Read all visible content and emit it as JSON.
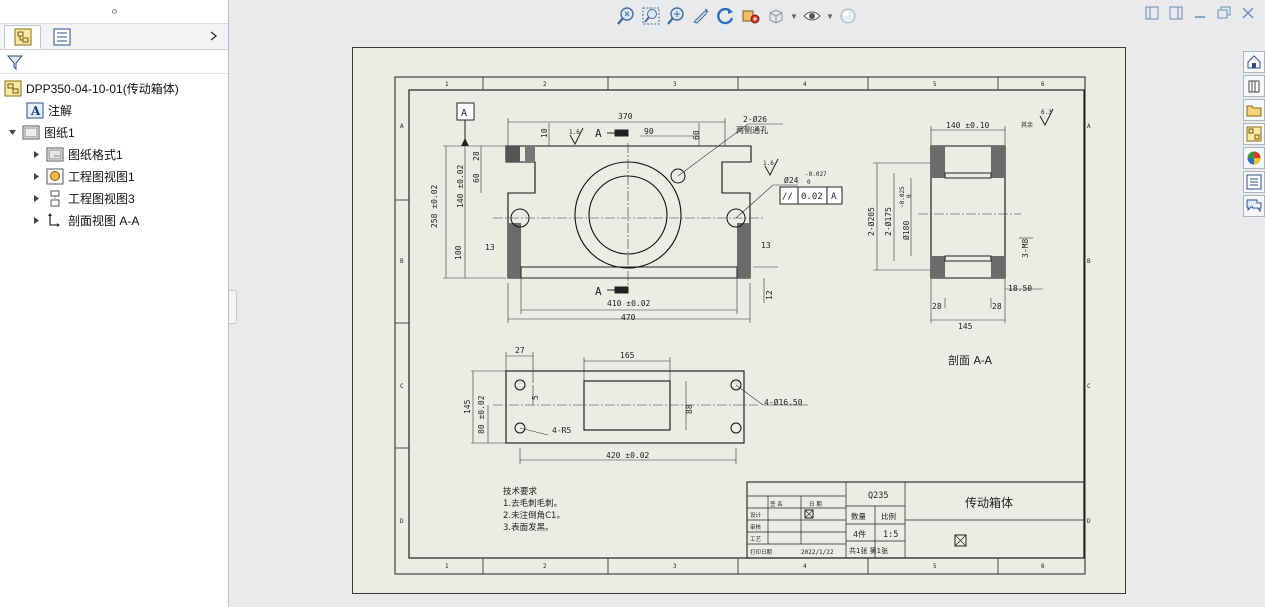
{
  "tree": {
    "root": "DPP350-04-10-01(传动箱体)",
    "annotations": "注解",
    "sheet": "图纸1",
    "children": [
      "图纸格式1",
      "工程图视图1",
      "工程图视图3",
      "剖面视图 A-A"
    ]
  },
  "toolbar": {
    "icons": [
      "zoom-to-fit-icon",
      "zoom-area-icon",
      "zoom-in-out-icon",
      "pan-icon",
      "rotate-icon",
      "view-orientation-icon",
      "display-style-icon",
      "hide-show-icon",
      "scene-icon"
    ]
  },
  "task_pane": {
    "icons": [
      "home-icon",
      "parts-library-icon",
      "file-explorer-icon",
      "view-palette-icon",
      "appearances-icon",
      "custom-properties-icon",
      "forum-icon"
    ]
  },
  "drawing": {
    "zone_columns": [
      "1",
      "2",
      "3",
      "4",
      "5",
      "6"
    ],
    "zone_rows": [
      "A",
      "B",
      "C",
      "D"
    ],
    "datum_label": "A",
    "section_marker": "A",
    "roughness_small": "1.6",
    "roughness_corner": "6.3",
    "roughness_rest_label": "其余",
    "front_view": {
      "dims": [
        "370",
        "90",
        "60",
        "10",
        "2-Ø26",
        "两侧通孔",
        "28",
        "60",
        "140 ±0.02",
        "258 ±0.02",
        "100",
        "13",
        "13",
        "12",
        "410 ±0.02",
        "470",
        "Ø24",
        "-0.027",
        "0"
      ],
      "tolerance_frame": [
        "//",
        "0.02",
        "A"
      ]
    },
    "section_view": {
      "dims": [
        "140 ±0.10",
        "2-Ø205",
        "2-Ø175",
        "Ø180",
        "-0.025",
        "0",
        "3-M8",
        "28",
        "28",
        "18.50",
        "145"
      ],
      "label": "剖面 A-A"
    },
    "top_view": {
      "dims": [
        "27",
        "165",
        "145",
        "80 ±0.02",
        "5",
        "88",
        "4-Ø16.50",
        "4-R5",
        "420 ±0.02"
      ]
    },
    "tech_requirements": [
      "技术要求",
      "1.去毛刺毛刺。",
      "2.未注倒角C1。",
      "3.表面发黑。"
    ],
    "title_block": {
      "material": "Q235",
      "part_name": "传动箱体",
      "quantity_label": "数量",
      "scale_label": "比例",
      "quantity": "4件",
      "scale": "1:5",
      "sheet_label": "共1张 第1张",
      "name_header": "签 名",
      "date_header": "日 期",
      "design_label": "设计",
      "review_label": "审核",
      "process_label": "工艺",
      "date_label": "打印日期",
      "date_value": "2022/1/22"
    }
  }
}
